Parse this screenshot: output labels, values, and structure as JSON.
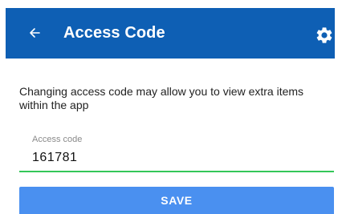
{
  "appbar": {
    "title": "Access Code",
    "back_icon": "arrow-left-icon",
    "settings_icon": "gear-icon",
    "background": "#0e5fb4"
  },
  "content": {
    "description": "Changing access code may allow you to view extra items within the app"
  },
  "access_code_field": {
    "label": "Access code",
    "value": "161781",
    "underline_color": "#34c759"
  },
  "save_button": {
    "label": "SAVE",
    "color": "#4a90f0"
  }
}
